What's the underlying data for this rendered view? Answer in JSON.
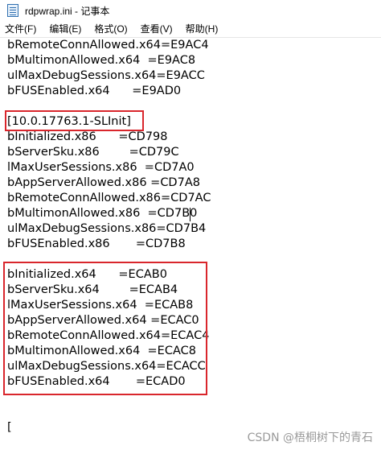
{
  "window": {
    "title": "rdpwrap.ini - 记事本",
    "icon": "notepad-icon"
  },
  "menu": [
    "文件(F)",
    "编辑(E)",
    "格式(O)",
    "查看(V)",
    "帮助(H)"
  ],
  "lines": [
    "bRemoteConnAllowed.x64=E9AC4",
    "bMultimonAllowed.x64  =E9AC8",
    "ulMaxDebugSessions.x64=E9ACC",
    "bFUSEnabled.x64      =E9AD0",
    "",
    "[10.0.17763.1-SLInit]",
    "bInitialized.x86      =CD798",
    "bServerSku.x86        =CD79C",
    "lMaxUserSessions.x86  =CD7A0",
    "bAppServerAllowed.x86 =CD7A8",
    "bRemoteConnAllowed.x86=CD7AC",
    "bMultimonAllowed.x86  =CD7B0",
    "ulMaxDebugSessions.x86=CD7B4",
    "bFUSEnabled.x86       =CD7B8",
    "",
    "bInitialized.x64      =ECAB0",
    "bServerSku.x64        =ECAB4",
    "lMaxUserSessions.x64  =ECAB8",
    "bAppServerAllowed.x64 =ECAC0",
    "bRemoteConnAllowed.x64=ECAC4",
    "bMultimonAllowed.x64  =ECAC8",
    "ulMaxDebugSessions.x64=ECACC",
    "bFUSEnabled.x64       =ECAD0",
    "",
    "",
    "["
  ],
  "watermark": "CSDN @梧桐树下的青石",
  "highlight_color": "#d9262c"
}
